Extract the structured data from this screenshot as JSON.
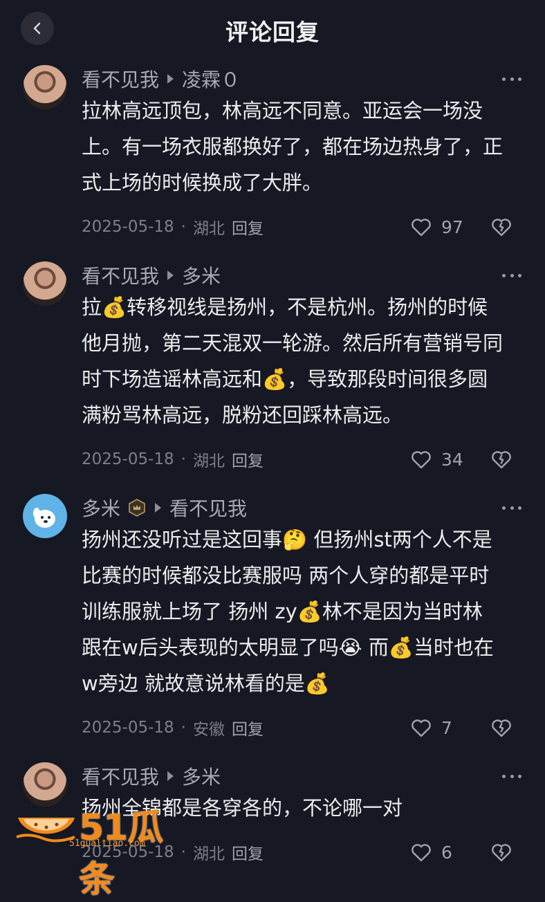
{
  "header": {
    "title": "评论回复"
  },
  "comments": [
    {
      "user": "看不见我",
      "reply_to": "凌霖０",
      "avatar": "man-avatar",
      "text": "拉林高远顶包，林高远不同意。亚运会一场没\n上。有一场衣服都换好了，都在场边热身了，正\n式上场的时候换成了大胖。",
      "date": "2025-05-18",
      "location": "湖北",
      "reply_label": "回复",
      "likes": "97"
    },
    {
      "user": "看不见我",
      "reply_to": "多米",
      "avatar": "man-avatar",
      "text": "拉💰转移视线是扬州，不是杭州。扬州的时候\n他月抛，第二天混双一轮游。然后所有营销号同\n时下场造谣林高远和💰，导致那段时间很多圆\n满粉骂林高远，脱粉还回踩林高远。",
      "date": "2025-05-18",
      "location": "湖北",
      "reply_label": "回复",
      "likes": "34"
    },
    {
      "user": "多米",
      "reply_to": "看不见我",
      "avatar": "dog-avatar",
      "text": "扬州还没听过是这回事🤔 但扬州st两个人不是\n比赛的时候都没比赛服吗  两个人穿的都是平时\n训练服就上场了  扬州 zy💰林不是因为当时林\n跟在w后头表现的太明显了吗😭 而💰当时也在\nw旁边   就故意说林看的是💰",
      "date": "2025-05-18",
      "location": "安徽",
      "reply_label": "回复",
      "likes": "7"
    },
    {
      "user": "看不见我",
      "reply_to": "多米",
      "avatar": "man-avatar",
      "text": "扬州全锦都是各穿各的，不论哪一对",
      "date": "2025-05-18",
      "location": "湖北",
      "reply_label": "回复",
      "likes": "6"
    }
  ],
  "watermark": {
    "logo_text": "51瓜条",
    "url": "51gualtiao.com"
  },
  "icons": [
    "back-chevron-icon",
    "more-icon",
    "heart-icon",
    "broken-heart-icon",
    "rank-badge-icon"
  ]
}
